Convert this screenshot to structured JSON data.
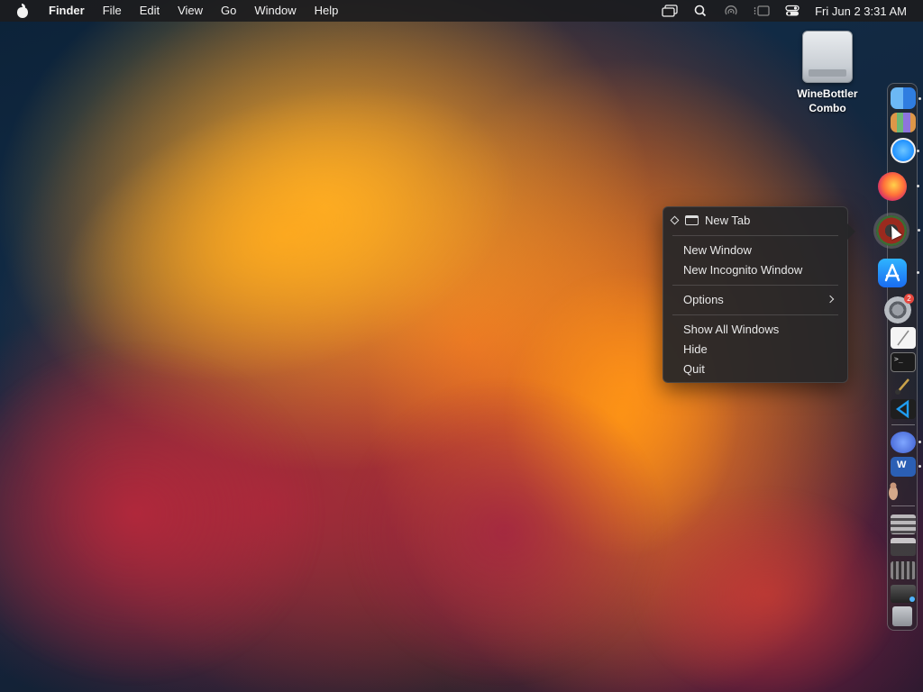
{
  "menubar": {
    "app_name": "Finder",
    "menus": [
      "File",
      "Edit",
      "View",
      "Go",
      "Window",
      "Help"
    ],
    "status_icons": [
      "screen-mirroring-icon",
      "search-icon",
      "airdrop-icon",
      "stage-manager-icon",
      "control-center-icon"
    ],
    "clock": "Fri Jun 2  3:31 AM"
  },
  "desktop": {
    "icon_label_line1": "WineBottler",
    "icon_label_line2": "Combo"
  },
  "context_menu": {
    "tab_label": "New Tab",
    "new_window": "New Window",
    "new_incognito": "New Incognito Window",
    "options": "Options",
    "show_all": "Show All Windows",
    "hide": "Hide",
    "quit": "Quit"
  },
  "dock": {
    "apps": [
      "finder-icon",
      "launchpad-icon",
      "safari-icon",
      "firefox-icon",
      "chrome-icon",
      "app-store-icon",
      "system-settings-icon",
      "textedit-icon",
      "terminal-icon",
      "brush-icon",
      "vscode-icon",
      "teams-icon",
      "word-icon",
      "character-icon"
    ],
    "settings_badge": "2",
    "colors": {
      "safari": "#1e90ff",
      "firefox": "#ff7139",
      "chrome": "#3a3a3a",
      "app_store": "#1a8cff",
      "vscode": "#1f9cf0",
      "word": "#2b5fb4",
      "teams": "#5b6abf"
    }
  }
}
